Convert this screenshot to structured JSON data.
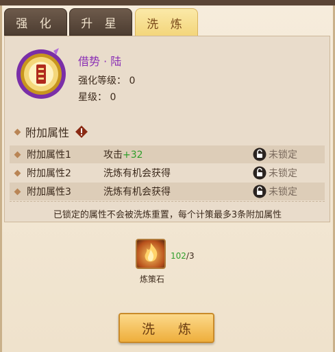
{
  "tabs": [
    {
      "label": "强 化",
      "active": false
    },
    {
      "label": "升 星",
      "active": false
    },
    {
      "label": "洗 炼",
      "active": true
    }
  ],
  "skill": {
    "name": "借势 · 陆",
    "enhance_level": "强化等级： 0",
    "star_level": "星级： 0",
    "emblem_icon": "scroll-seal-icon"
  },
  "attributes": {
    "title": "附加属性",
    "rows": [
      {
        "name": "附加属性1",
        "value_prefix": "攻击",
        "value_bonus": "+32",
        "lock_label": "未锁定"
      },
      {
        "name": "附加属性2",
        "value_prefix": "洗炼有机会获得",
        "value_bonus": "",
        "lock_label": "未锁定"
      },
      {
        "name": "附加属性3",
        "value_prefix": "洗炼有机会获得",
        "value_bonus": "",
        "lock_label": "未锁定"
      }
    ],
    "note": "已锁定的属性不会被洗炼重置，每个计策最多3条附加属性"
  },
  "material": {
    "name": "炼策石",
    "have": "102",
    "need": "/3",
    "icon": "flame-stone-icon"
  },
  "action": {
    "label": "洗 炼"
  },
  "colors": {
    "accent_purple": "#8a2fb5",
    "bonus_green": "#2e9e2a",
    "tab_active": "#f3d57a"
  }
}
